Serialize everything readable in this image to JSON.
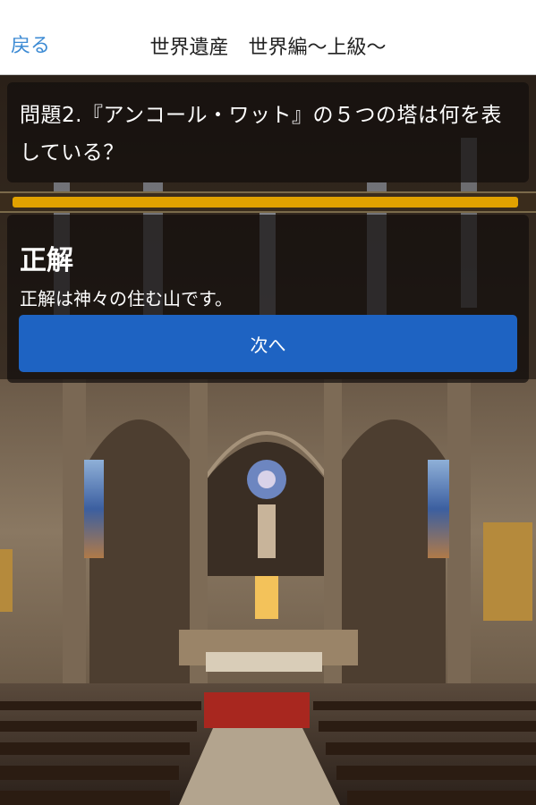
{
  "nav": {
    "back_label": "戻る",
    "title": "世界遺産　世界編〜上級〜"
  },
  "question": {
    "text": "問題2.『アンコール・ワット』の５つの塔は何を表している？"
  },
  "progress": {
    "fraction": 0.99,
    "color": "#e1a200"
  },
  "answer": {
    "result_label": "正解",
    "explanation": "正解は神々の住む山です。",
    "next_label": "次へ"
  },
  "colors": {
    "accent": "#3d8bd4",
    "button": "#1e63c2"
  }
}
